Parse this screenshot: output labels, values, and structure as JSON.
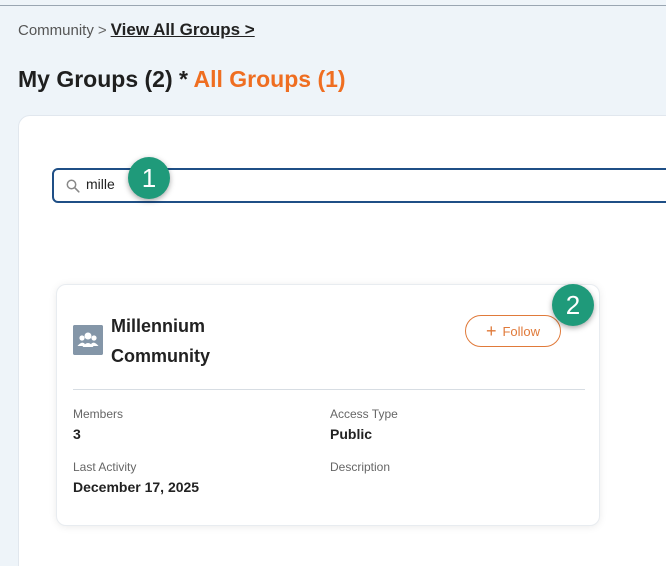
{
  "breadcrumb": {
    "root": "Community",
    "separator": ">",
    "link": "View All Groups >"
  },
  "title": {
    "my_groups": "My Groups (2)",
    "separator": "*",
    "all_groups": "All Groups (1)"
  },
  "search": {
    "value": "mille",
    "icon": "search-icon"
  },
  "markers": [
    "1",
    "2"
  ],
  "group": {
    "name": "Millennium Community",
    "icon": "group-icon",
    "follow_label": "Follow",
    "fields": {
      "members_label": "Members",
      "members_value": "3",
      "access_label": "Access Type",
      "access_value": "Public",
      "activity_label": "Last Activity",
      "activity_value": "December 17, 2025",
      "description_label": "Description"
    }
  },
  "colors": {
    "accent": "#ef6e21",
    "marker": "#1f9a7a",
    "search_border": "#1f4f86"
  }
}
